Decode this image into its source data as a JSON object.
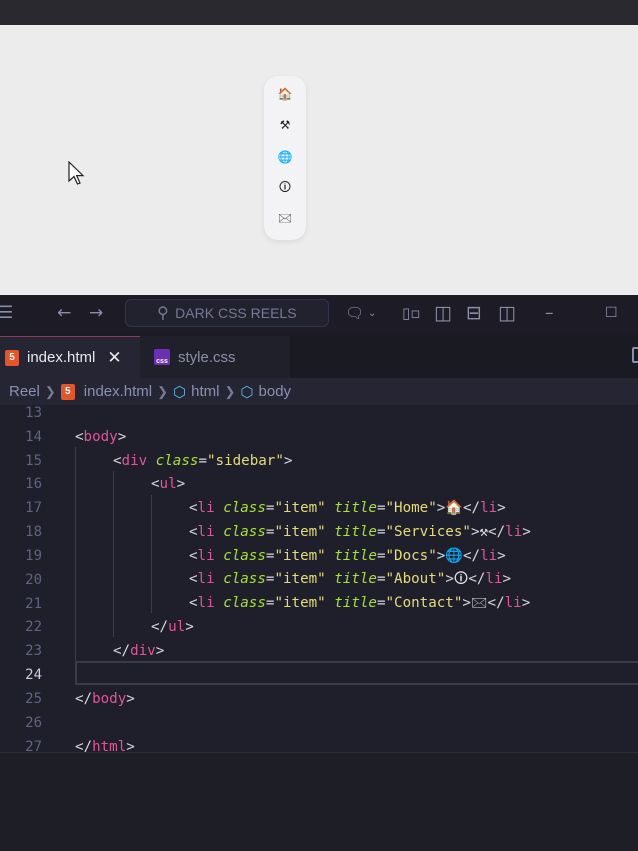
{
  "preview": {
    "sidebar_items": [
      {
        "title": "Home",
        "icon": "🏠",
        "icon_name": "house-icon"
      },
      {
        "title": "Services",
        "icon": "⚒",
        "icon_name": "hammer-pick-icon"
      },
      {
        "title": "Docs",
        "icon": "🌐",
        "icon_name": "globe-icon"
      },
      {
        "title": "About",
        "icon": "🛈",
        "icon_name": "info-icon"
      },
      {
        "title": "Contact",
        "icon": "🖂",
        "icon_name": "envelope-icon"
      }
    ]
  },
  "titlebar": {
    "search_label": "DARK CSS REELS"
  },
  "tabs": [
    {
      "label": "index.html",
      "active": true
    },
    {
      "label": "style.css",
      "active": false
    }
  ],
  "breadcrumb": [
    "Reel",
    "index.html",
    "html",
    "body"
  ],
  "editor": {
    "current_line": 24,
    "lines": [
      {
        "n": 13,
        "indent": 0,
        "tokens": []
      },
      {
        "n": 14,
        "indent": 0,
        "tokens": [
          [
            "b",
            "<"
          ],
          [
            "t",
            "body"
          ],
          [
            "b",
            ">"
          ]
        ]
      },
      {
        "n": 15,
        "indent": 1,
        "tokens": [
          [
            "b",
            "<"
          ],
          [
            "t",
            "div"
          ],
          [
            "e",
            " "
          ],
          [
            "a",
            "class"
          ],
          [
            "b",
            "="
          ],
          [
            "s",
            "\"sidebar\""
          ],
          [
            "b",
            ">"
          ]
        ]
      },
      {
        "n": 16,
        "indent": 2,
        "tokens": [
          [
            "b",
            "<"
          ],
          [
            "t",
            "ul"
          ],
          [
            "b",
            ">"
          ]
        ]
      },
      {
        "n": 17,
        "indent": 3,
        "tokens": [
          [
            "b",
            "<"
          ],
          [
            "t",
            "li"
          ],
          [
            "e",
            " "
          ],
          [
            "a",
            "class"
          ],
          [
            "b",
            "="
          ],
          [
            "s",
            "\"item\""
          ],
          [
            "e",
            " "
          ],
          [
            "a",
            "title"
          ],
          [
            "b",
            "="
          ],
          [
            "s",
            "\"Home\""
          ],
          [
            "b",
            ">"
          ],
          [
            "e",
            "🏠"
          ],
          [
            "b",
            "</"
          ],
          [
            "t",
            "li"
          ],
          [
            "b",
            ">"
          ]
        ]
      },
      {
        "n": 18,
        "indent": 3,
        "tokens": [
          [
            "b",
            "<"
          ],
          [
            "t",
            "li"
          ],
          [
            "e",
            " "
          ],
          [
            "a",
            "class"
          ],
          [
            "b",
            "="
          ],
          [
            "s",
            "\"item\""
          ],
          [
            "e",
            " "
          ],
          [
            "a",
            "title"
          ],
          [
            "b",
            "="
          ],
          [
            "s",
            "\"Services\""
          ],
          [
            "b",
            ">"
          ],
          [
            "e",
            "⚒"
          ],
          [
            "b",
            "</"
          ],
          [
            "t",
            "li"
          ],
          [
            "b",
            ">"
          ]
        ]
      },
      {
        "n": 19,
        "indent": 3,
        "tokens": [
          [
            "b",
            "<"
          ],
          [
            "t",
            "li"
          ],
          [
            "e",
            " "
          ],
          [
            "a",
            "class"
          ],
          [
            "b",
            "="
          ],
          [
            "s",
            "\"item\""
          ],
          [
            "e",
            " "
          ],
          [
            "a",
            "title"
          ],
          [
            "b",
            "="
          ],
          [
            "s",
            "\"Docs\""
          ],
          [
            "b",
            ">"
          ],
          [
            "e",
            "🌐"
          ],
          [
            "b",
            "</"
          ],
          [
            "t",
            "li"
          ],
          [
            "b",
            ">"
          ]
        ]
      },
      {
        "n": 20,
        "indent": 3,
        "tokens": [
          [
            "b",
            "<"
          ],
          [
            "t",
            "li"
          ],
          [
            "e",
            " "
          ],
          [
            "a",
            "class"
          ],
          [
            "b",
            "="
          ],
          [
            "s",
            "\"item\""
          ],
          [
            "e",
            " "
          ],
          [
            "a",
            "title"
          ],
          [
            "b",
            "="
          ],
          [
            "s",
            "\"About\""
          ],
          [
            "b",
            ">"
          ],
          [
            "e",
            "🛈"
          ],
          [
            "b",
            "</"
          ],
          [
            "t",
            "li"
          ],
          [
            "b",
            ">"
          ]
        ]
      },
      {
        "n": 21,
        "indent": 3,
        "tokens": [
          [
            "b",
            "<"
          ],
          [
            "t",
            "li"
          ],
          [
            "e",
            " "
          ],
          [
            "a",
            "class"
          ],
          [
            "b",
            "="
          ],
          [
            "s",
            "\"item\""
          ],
          [
            "e",
            " "
          ],
          [
            "a",
            "title"
          ],
          [
            "b",
            "="
          ],
          [
            "s",
            "\"Contact\""
          ],
          [
            "b",
            ">"
          ],
          [
            "e",
            "🖂"
          ],
          [
            "b",
            "</"
          ],
          [
            "t",
            "li"
          ],
          [
            "b",
            ">"
          ]
        ]
      },
      {
        "n": 22,
        "indent": 2,
        "tokens": [
          [
            "b",
            "</"
          ],
          [
            "t",
            "ul"
          ],
          [
            "b",
            ">"
          ]
        ]
      },
      {
        "n": 23,
        "indent": 1,
        "tokens": [
          [
            "b",
            "</"
          ],
          [
            "t",
            "div"
          ],
          [
            "b",
            ">"
          ]
        ]
      },
      {
        "n": 24,
        "indent": 0,
        "tokens": []
      },
      {
        "n": 25,
        "indent": 0,
        "tokens": [
          [
            "b",
            "</"
          ],
          [
            "t",
            "body"
          ],
          [
            "b",
            ">"
          ]
        ]
      },
      {
        "n": 26,
        "indent": 0,
        "tokens": []
      },
      {
        "n": 27,
        "indent": 0,
        "tokens": [
          [
            "b",
            "</"
          ],
          [
            "t",
            "html"
          ],
          [
            "b",
            ">"
          ]
        ]
      }
    ]
  },
  "colors": {
    "tag": "#e0559a",
    "attribute": "#a6e22e",
    "string": "#e6db74",
    "editor_bg": "#1f1f2b",
    "preview_bg": "#ececec"
  }
}
